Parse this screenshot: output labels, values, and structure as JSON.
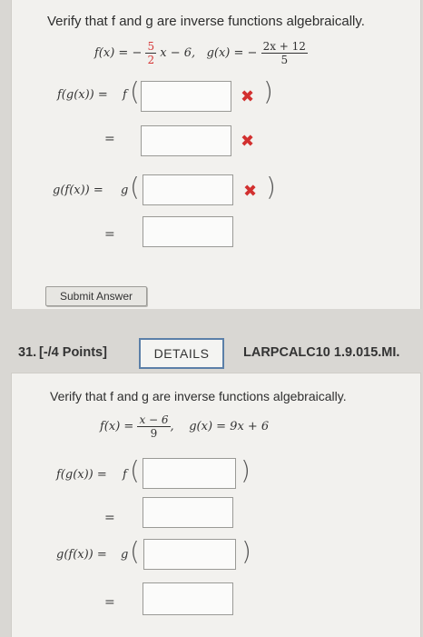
{
  "q30": {
    "prompt": "Verify that f and g are inverse functions algebraically.",
    "f_lhs": "f(x) = −",
    "f_frac_num": "5",
    "f_frac_den": "2",
    "f_rest": "x − 6,",
    "g_lhs": "g(x) = −",
    "g_frac_num": "2x + 12",
    "g_frac_den": "5",
    "fg_label": "f(g(x)) =",
    "gf_label": "g(f(x)) =",
    "f_letter": "f",
    "g_letter": "g",
    "equals": "=",
    "wrong_mark": "✖",
    "paren_open": "(",
    "paren_close": ")",
    "submit_label": "Submit Answer"
  },
  "q31": {
    "number": "31.",
    "points": "[-/4 Points]",
    "details_label": "DETAILS",
    "code": "LARPCALC10 1.9.015.MI.",
    "prompt": "Verify that f and g are inverse functions algebraically.",
    "f_lhs": "f(x) =",
    "f_frac_num": "x − 6",
    "f_frac_den": "9",
    "comma": ",",
    "g_def": "g(x) = 9x + 6",
    "fg_label": "f(g(x)) =",
    "gf_label": "g(f(x)) =",
    "f_letter": "f",
    "g_letter": "g",
    "equals": "=",
    "paren_open": "(",
    "paren_close": ")"
  },
  "colors": {
    "error": "#d2302f",
    "details_border": "#5b7fa8",
    "card_bg": "#f2f1ee"
  }
}
